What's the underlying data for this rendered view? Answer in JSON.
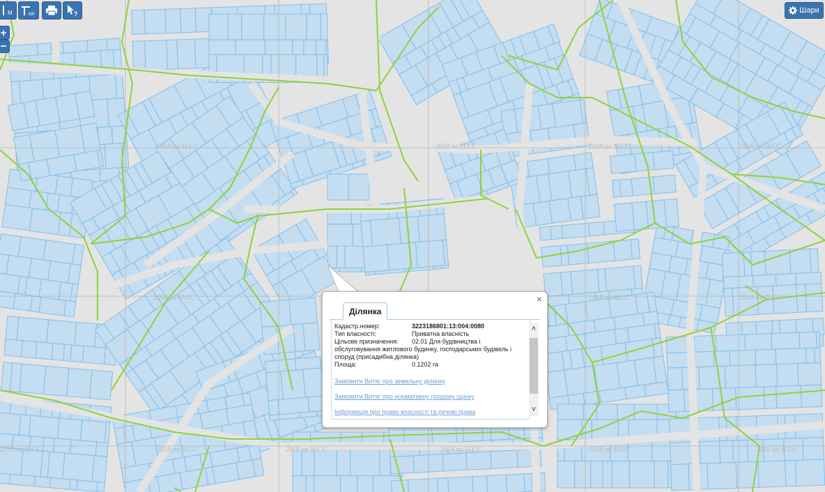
{
  "map": {
    "background": "#e4e4e4",
    "parcel_fill": "#c4ddf0",
    "parcel_stroke": "#83bfea",
    "boundary_color": "#8fd13a",
    "grid_color": "#b5b5b5",
    "watermark_text": "2018 па SLCC"
  },
  "toolbar": {
    "measure_line_icon": "ruler-line-icon",
    "measure_area_icon": "ruler-area-icon",
    "print_icon": "printer-icon",
    "identify_icon": "cursor-question-icon",
    "zoom_in_label": "+",
    "zoom_out_label": "−",
    "measure_line_label": "M",
    "measure_area_label": "МР"
  },
  "layers_button": {
    "label": "Шари",
    "icon": "gear-icon"
  },
  "popup": {
    "close_label": "×",
    "tab_label": "Ділянка",
    "fields": {
      "cadastral_label": "Кадастр.номер:",
      "cadastral_value": "3223186801:13:004:0080",
      "ownership_label": "Тип власності:",
      "ownership_value": "Приватна власність",
      "purpose_label": "Цільове призначення:",
      "purpose_value_first": "02.01 Для будівництва і",
      "purpose_value_rest": "обслуговування житлового будинку, господарських будівель і споруд (присадибна ділянка)",
      "area_label": "Площа:",
      "area_value": "0.1202 га"
    },
    "links": [
      "Замовити Витяг про земельну ділянку",
      "Замовити Витяг про нормативну грошову оцінку",
      "Інформація про право власності та речові права"
    ],
    "scroll_up": "˄",
    "scroll_down": "˅"
  }
}
